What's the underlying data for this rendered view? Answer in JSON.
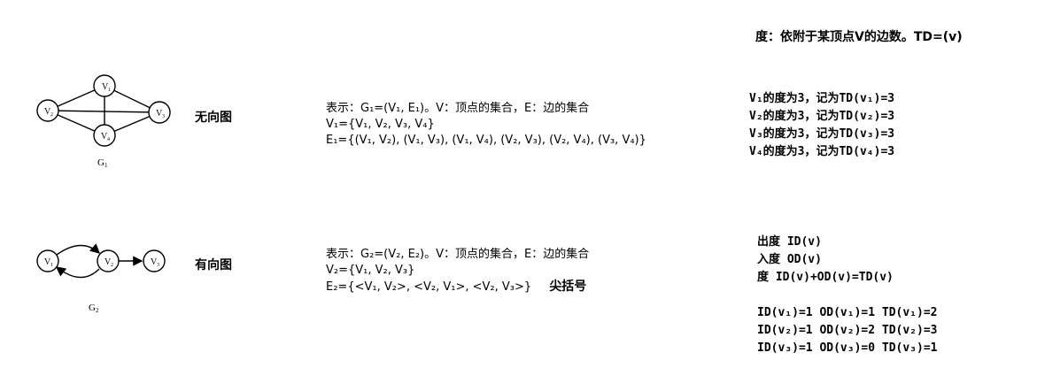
{
  "definition": "度：依附于某顶点V的边数。TD=(v)",
  "undirected": {
    "graph_name": "G",
    "graph_sub": "1",
    "nodes": [
      {
        "label": "V",
        "sub": "1"
      },
      {
        "label": "V",
        "sub": "2"
      },
      {
        "label": "V",
        "sub": "3"
      },
      {
        "label": "V",
        "sub": "4"
      }
    ],
    "type_label": "无向图",
    "repr": [
      "表示：G₁=(V₁, E₁)。V：顶点的集合，E：边的集合",
      "V₁={V₁, V₂, V₃, V₄}",
      "E₁={(V₁, V₂), (V₁, V₃), (V₁, V₄), (V₂, V₃), (V₂, V₄), (V₃, V₄)}"
    ],
    "degrees": [
      "V₁的度为3，记为TD(v₁)=3",
      "V₂的度为3，记为TD(v₂)=3",
      "V₃的度为3，记为TD(v₃)=3",
      "V₄的度为3，记为TD(v₄)=3"
    ]
  },
  "directed": {
    "graph_name": "G",
    "graph_sub": "2",
    "nodes": [
      {
        "label": "V",
        "sub": "1"
      },
      {
        "label": "V",
        "sub": "2"
      },
      {
        "label": "V",
        "sub": "3"
      }
    ],
    "type_label": "有向图",
    "repr": [
      "表示：G₂=(V₂, E₂)。V：顶点的集合，E：边的集合",
      "V₂={V₁, V₂, V₃}",
      "E₂={<V₁, V₂>, <V₂, V₁>, <V₂, V₃>}"
    ],
    "bracket_note": "尖括号",
    "degree_defs": [
      "出度 ID(v)",
      "入度 OD(v)",
      "度 ID(v)+OD(v)=TD(v)"
    ],
    "degree_values": [
      "ID(v₁)=1 OD(v₁)=1 TD(v₁)=2",
      "ID(v₂)=1 OD(v₂)=2 TD(v₂)=3",
      "ID(v₃)=1 OD(v₃)=0 TD(v₃)=1"
    ]
  }
}
